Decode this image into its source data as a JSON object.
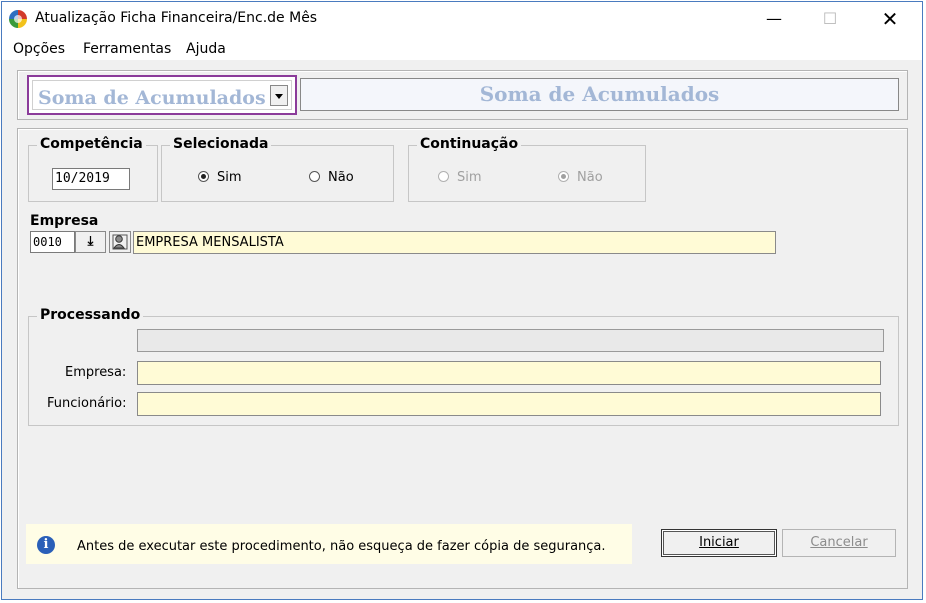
{
  "window": {
    "title": "Atualização Ficha Financeira/Enc.de Mês",
    "minimize": "—",
    "maximize": "☐",
    "close": "✕"
  },
  "menu": [
    "Opções",
    "Ferramentas",
    "Ajuda"
  ],
  "procedure": {
    "combo_value": "Soma de Acumulados",
    "banner": "Soma de Acumulados"
  },
  "competencia": {
    "label": "Competência",
    "value": "10/2019"
  },
  "selecionada": {
    "label": "Selecionada",
    "options": [
      "Sim",
      "Não"
    ],
    "selected": "Sim"
  },
  "continuacao": {
    "label": "Continuação",
    "options": [
      "Sim",
      "Não"
    ],
    "selected": "Não",
    "enabled": false
  },
  "empresa": {
    "label": "Empresa",
    "code": "0010",
    "name": "EMPRESA MENSALISTA",
    "lookup_icon": "download-arrow-icon",
    "search_icon": "person-search-icon"
  },
  "processando": {
    "label": "Processando",
    "progress": 0,
    "empresa_label": "Empresa:",
    "empresa_value": "",
    "funcionario_label": "Funcionário:",
    "funcionario_value": ""
  },
  "info": {
    "icon": "info-icon",
    "text": "Antes de executar este procedimento, não esqueça de fazer cópia de segurança."
  },
  "buttons": {
    "iniciar": "Iniciar",
    "cancelar": "Cancelar"
  },
  "colors": {
    "banner_text": "#a3b7d6",
    "combo_border": "#8b3b9a",
    "field_yellow": "#fffbd6"
  }
}
